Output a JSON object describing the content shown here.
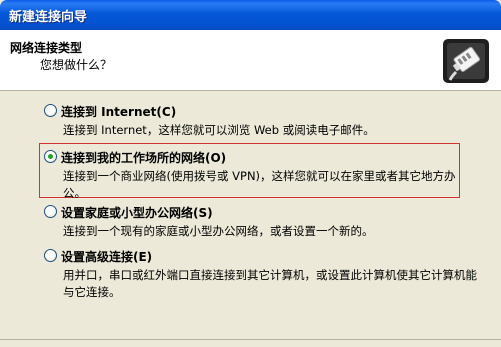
{
  "window": {
    "title": "新建连接向导"
  },
  "header": {
    "title": "网络连接类型",
    "subtitle": "您想做什么？",
    "icon": "network-cable-plug-icon"
  },
  "options": [
    {
      "label": "连接到 Internet(C)",
      "description": "连接到 Internet，这样您就可以浏览 Web 或阅读电子邮件。",
      "selected": false
    },
    {
      "label": "连接到我的工作场所的网络(O)",
      "description": "连接到一个商业网络(使用拨号或 VPN)，这样您就可以在家里或者其它地方办公。",
      "selected": true
    },
    {
      "label": "设置家庭或小型办公网络(S)",
      "description": "连接到一个现有的家庭或小型办公网络，或者设置一个新的。",
      "selected": false
    },
    {
      "label": "设置高级连接(E)",
      "description": "用并口，串口或红外端口直接连接到其它计算机，或设置此计算机使其它计算机能与它连接。",
      "selected": false
    }
  ],
  "colors": {
    "titlebar": "#0458D8",
    "dialog_bg": "#ECE9D8",
    "selection_outline": "#D4342F",
    "radio_dot": "#21A121"
  }
}
